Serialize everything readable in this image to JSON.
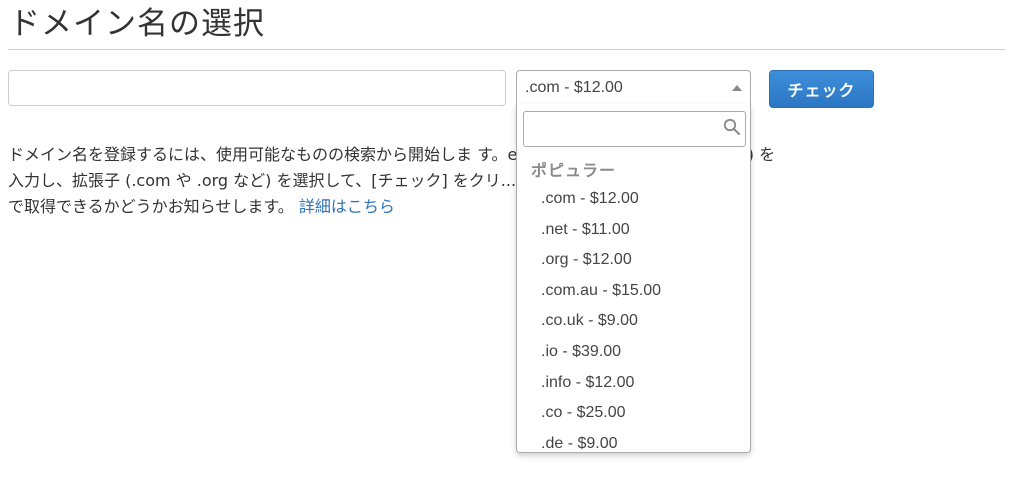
{
  "header": {
    "title": "ドメイン名の選択"
  },
  "form": {
    "domain_input_value": "",
    "tld_selected": ".com - $12.00",
    "check_label": "チェック"
  },
  "description": {
    "line1": "ドメイン名を登録するには、使用可能なものの検索から開始しま す。example.com の example など) を",
    "line2": "入力し、拡張子 (.com や .org など) を選択して、[チェック] をクリ...能かどうか、および他の拡張子",
    "line3": "で取得できるかどうかお知らせします。",
    "learn_more": "詳細はこちら"
  },
  "dropdown": {
    "search_value": "",
    "group_label": "ポピュラー",
    "options": [
      ".com - $12.00",
      ".net - $11.00",
      ".org - $12.00",
      ".com.au - $15.00",
      ".co.uk - $9.00",
      ".io - $39.00",
      ".info - $12.00",
      ".co - $25.00",
      ".de - $9.00"
    ]
  },
  "icons": {
    "search": "search-icon",
    "select_arrow": "caret-up-icon"
  },
  "colors": {
    "accent": "#2c76c3",
    "link": "#2f73b8",
    "group_label": "#8a8a8a"
  }
}
